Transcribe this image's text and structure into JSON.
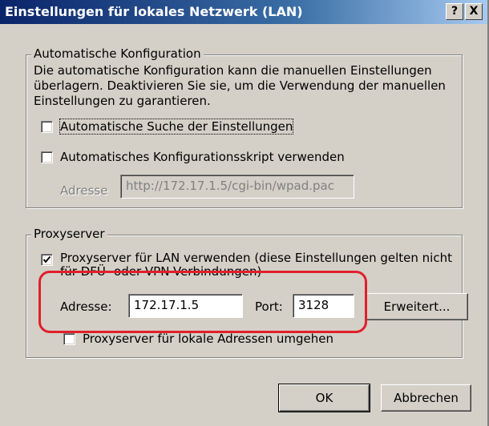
{
  "window": {
    "title": "Einstellungen für lokales Netzwerk (LAN)",
    "help_label": "?",
    "close_label": "X"
  },
  "auto_config": {
    "legend": "Automatische Konfiguration",
    "description_line1": "Die automatische Konfiguration kann die manuellen Einstellungen",
    "description_line2": "überlagern. Deaktivieren Sie sie, um die Verwendung der manuellen",
    "description_line3": "Einstellungen zu garantieren.",
    "auto_detect_label": "Automatische Suche der Einstellungen",
    "auto_detect_checked": false,
    "script_label": "Automatisches Konfigurationsskript verwenden",
    "script_checked": false,
    "address_label": "Adresse",
    "address_value": "http://172.17.1.5/cgi-bin/wpad.pac"
  },
  "proxy": {
    "legend": "Proxyserver",
    "use_proxy_label_line1": "Proxyserver für LAN verwenden (diese Einstellungen gelten nicht",
    "use_proxy_label_line2": "für DFÜ- oder VPN-Verbindungen)",
    "use_proxy_checked": true,
    "address_label": "Adresse:",
    "address_value": "172.17.1.5",
    "port_label": "Port:",
    "port_value": "3128",
    "advanced_button": "Erweitert...",
    "bypass_local_label": "Proxyserver für lokale Adressen umgehen",
    "bypass_local_checked": false
  },
  "buttons": {
    "ok": "OK",
    "cancel": "Abbrechen"
  },
  "colors": {
    "title_bar": "#0a246a",
    "dialog_bg": "#d4d0c8",
    "highlight": "#e0202a"
  }
}
